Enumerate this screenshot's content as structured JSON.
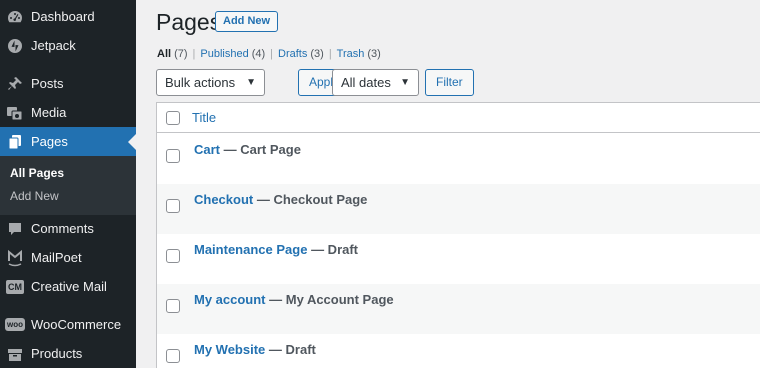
{
  "sidebar": {
    "items": [
      {
        "label": "Dashboard",
        "icon": "dashboard-icon"
      },
      {
        "label": "Jetpack",
        "icon": "jetpack-icon"
      },
      {
        "label": "Posts",
        "icon": "pin-icon"
      },
      {
        "label": "Media",
        "icon": "media-icon"
      },
      {
        "label": "Pages",
        "icon": "pages-icon"
      },
      {
        "label": "Comments",
        "icon": "comment-icon"
      },
      {
        "label": "MailPoet",
        "icon": "mailpoet-icon"
      },
      {
        "label": "Creative Mail",
        "icon": "creative-mail-icon",
        "badge": "CM"
      },
      {
        "label": "WooCommerce",
        "icon": "woocommerce-icon",
        "badge": "woo"
      },
      {
        "label": "Products",
        "icon": "products-icon"
      }
    ],
    "submenu": [
      "All Pages",
      "Add New"
    ],
    "accent_color": "#2271b1"
  },
  "header": {
    "title": "Pages",
    "add_new_label": "Add New"
  },
  "filters": [
    {
      "label": "All",
      "count": "(7)"
    },
    {
      "label": "Published",
      "count": "(4)"
    },
    {
      "label": "Drafts",
      "count": "(3)"
    },
    {
      "label": "Trash",
      "count": "(3)"
    }
  ],
  "tablenav": {
    "bulk_actions": "Bulk actions",
    "apply_label": "Apply",
    "dates": "All dates",
    "filter_label": "Filter"
  },
  "table": {
    "column_title": "Title",
    "rows": [
      {
        "title": "Cart",
        "state": "— Cart Page"
      },
      {
        "title": "Checkout",
        "state": "— Checkout Page"
      },
      {
        "title": "Maintenance Page",
        "state": "— Draft"
      },
      {
        "title": "My account",
        "state": "— My Account Page"
      },
      {
        "title": "My Website",
        "state": "— Draft"
      }
    ]
  }
}
